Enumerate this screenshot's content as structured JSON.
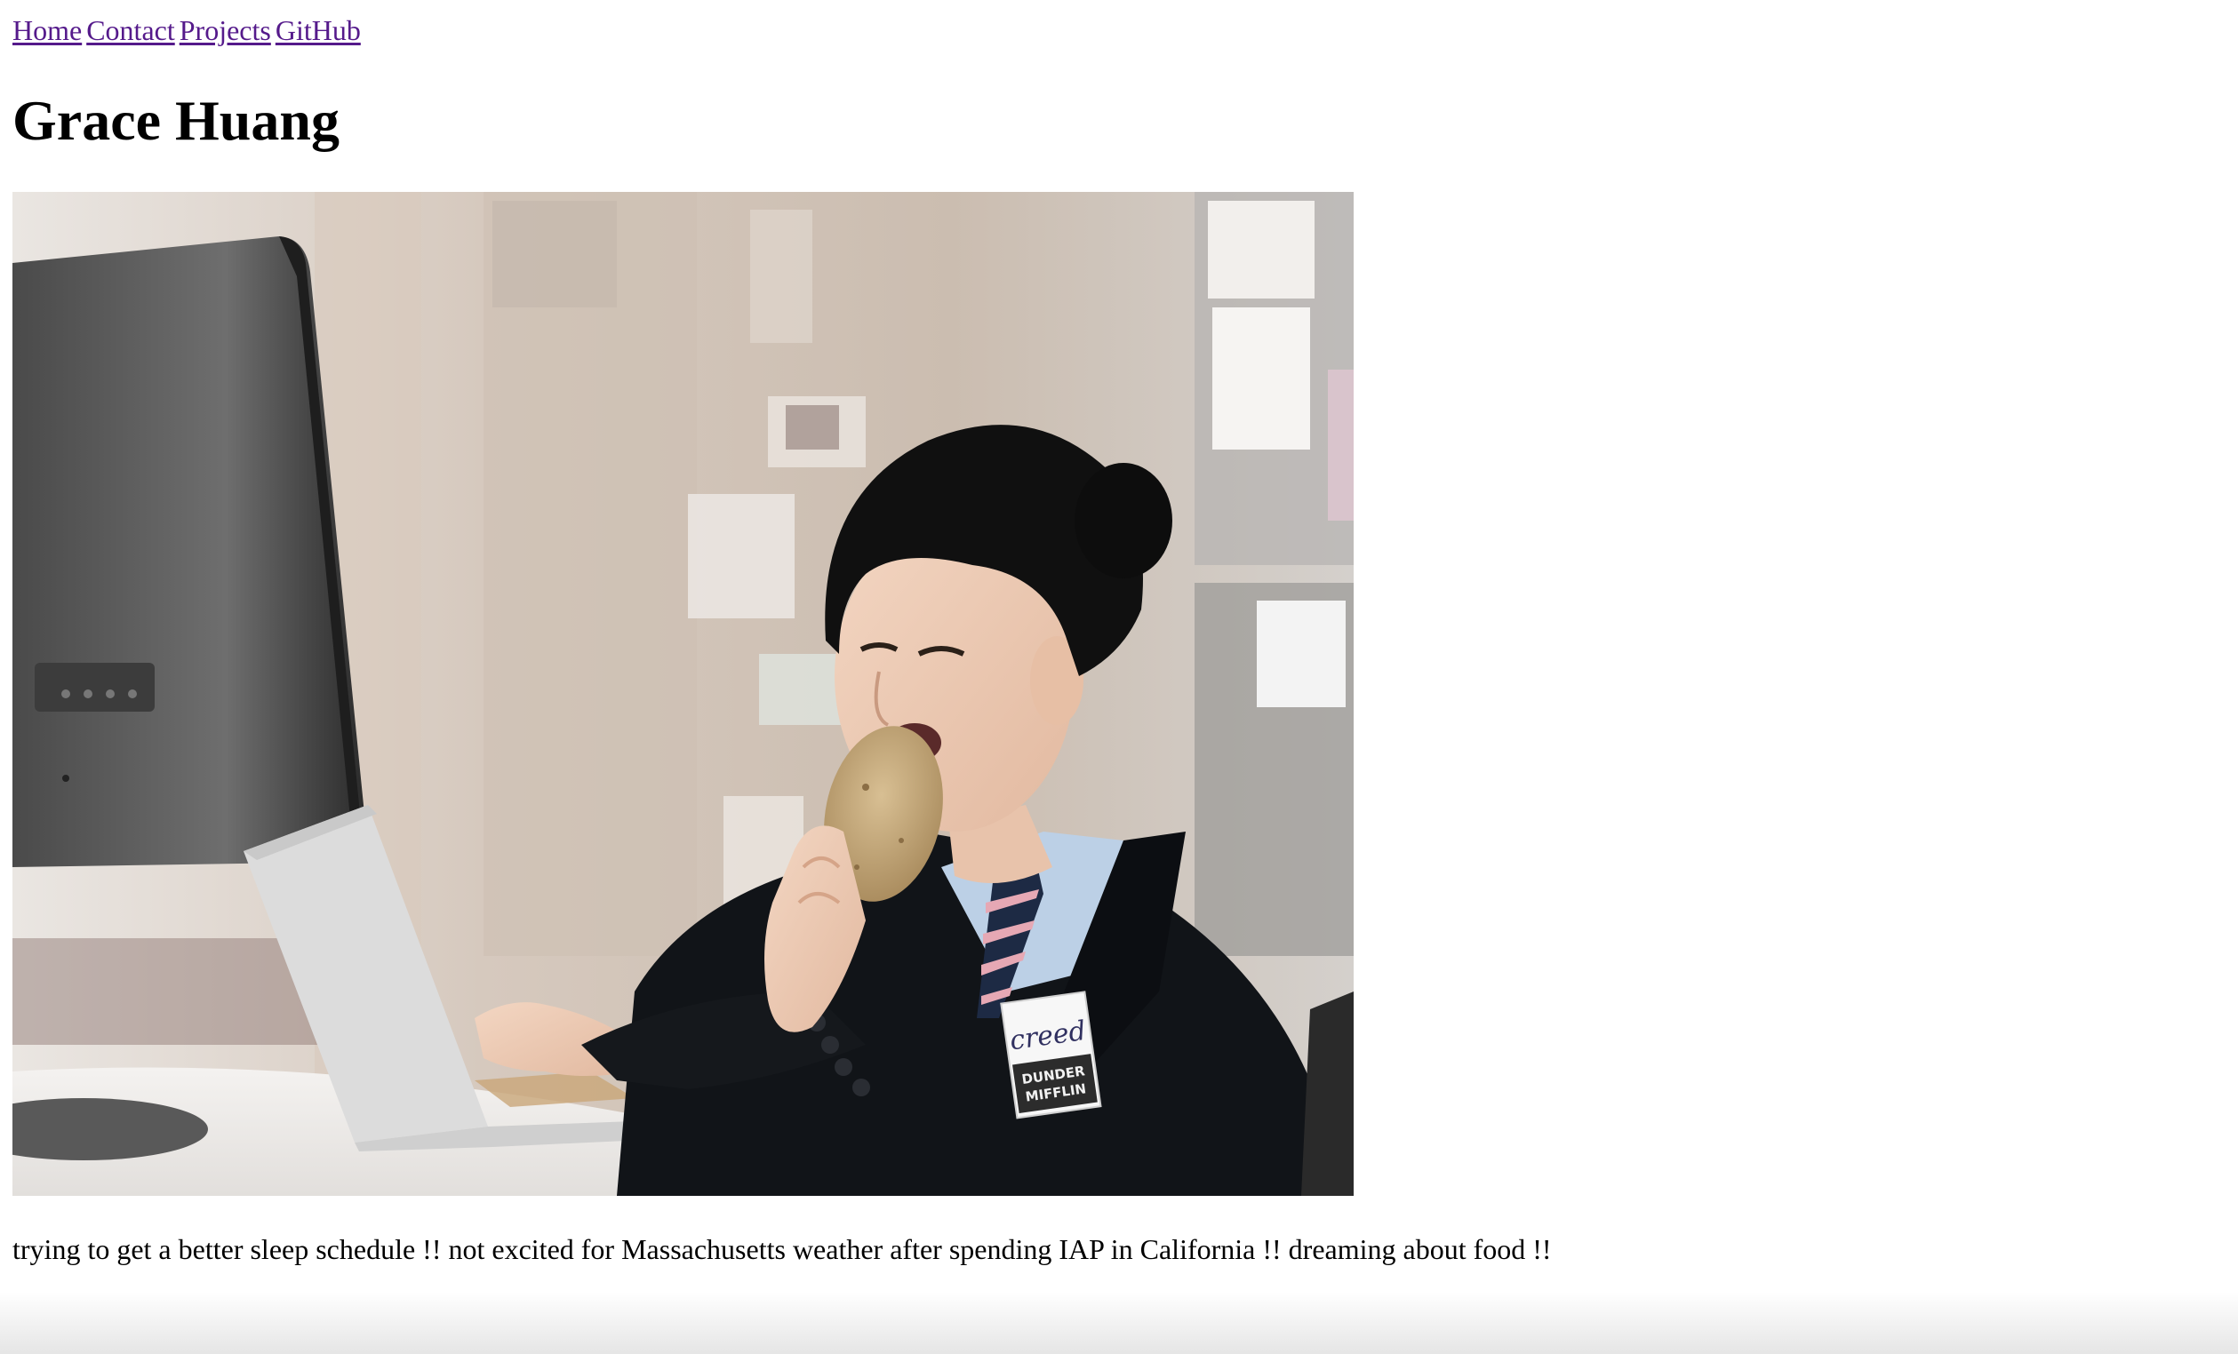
{
  "nav": {
    "links": [
      "Home",
      "Contact",
      "Projects",
      "GitHub"
    ],
    "link_color": "#551a8b"
  },
  "page": {
    "title": "Grace Huang",
    "bio": "trying to get a better sleep schedule !! not excited for Massachusetts weather after spending IAP in California !! dreaming about food !!"
  },
  "photo": {
    "badge_name": "creed",
    "badge_logo_line1": "DUNDER",
    "badge_logo_line2": "MIFFLIN"
  }
}
